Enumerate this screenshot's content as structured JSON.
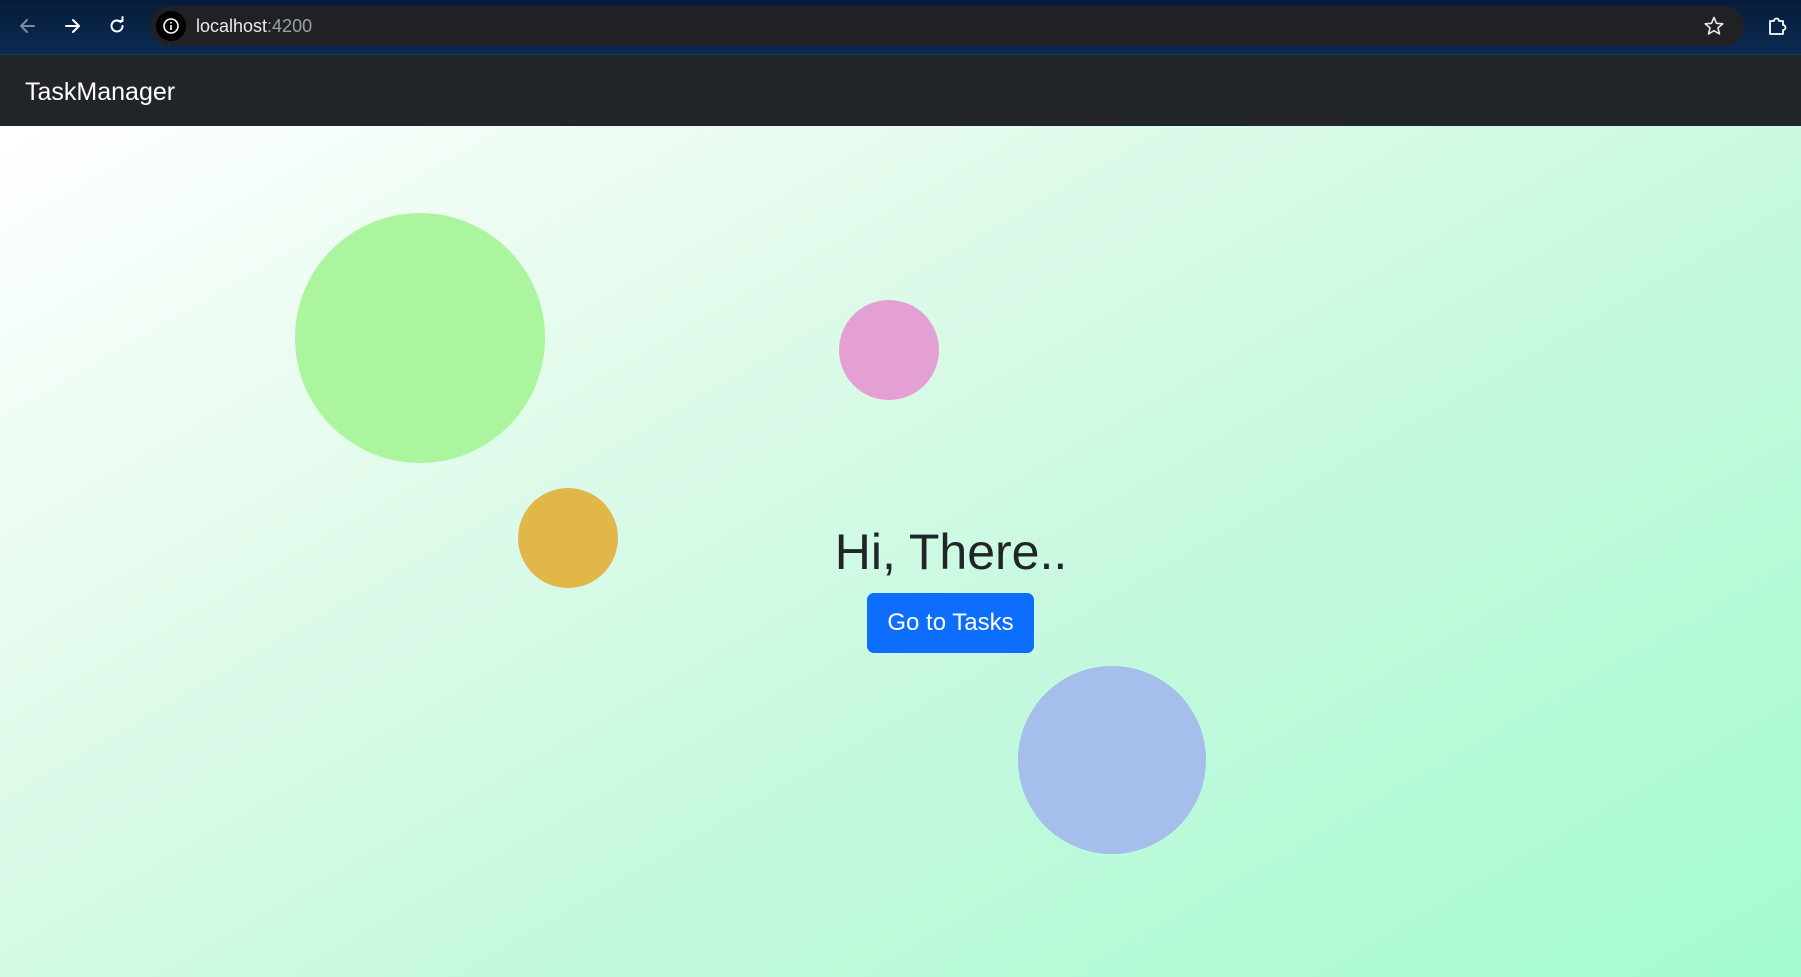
{
  "browser": {
    "url_host": "localhost",
    "url_port": ":4200",
    "icons": {
      "back": "arrow-left-icon",
      "forward": "arrow-right-icon",
      "reload": "reload-icon",
      "site_info": "info-icon",
      "bookmark": "star-icon",
      "extensions": "puzzle-icon"
    }
  },
  "navbar": {
    "brand": "TaskManager"
  },
  "hero": {
    "title": "Hi, There..",
    "button_label": "Go to Tasks"
  },
  "decorations": {
    "circles": [
      {
        "name": "green",
        "color": "#abf59e"
      },
      {
        "name": "pink",
        "color": "#e49fd3"
      },
      {
        "name": "orange",
        "color": "#e2b749"
      },
      {
        "name": "blue",
        "color": "#a6beec"
      }
    ]
  },
  "colors": {
    "primary_button": "#0d6efd",
    "navbar_bg": "#212529",
    "title_text": "#212529"
  }
}
